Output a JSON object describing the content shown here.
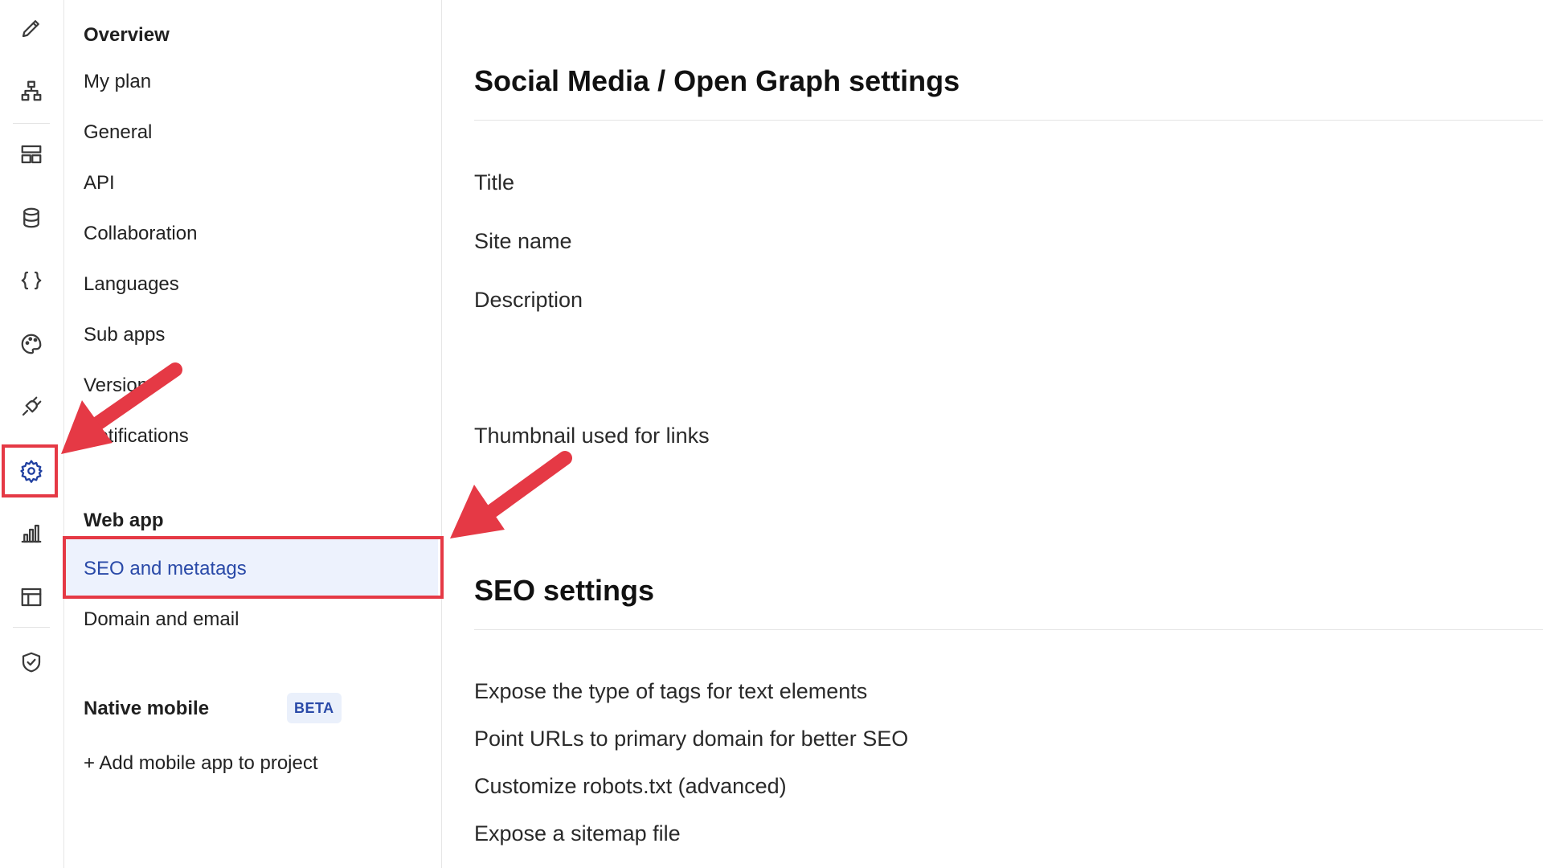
{
  "rail": {
    "icons": [
      "pencil-icon",
      "hierarchy-icon",
      "layout-icon",
      "database-icon",
      "code-braces-icon",
      "palette-icon",
      "plug-icon",
      "gear-icon",
      "bar-chart-icon",
      "table-icon",
      "shield-check-icon"
    ],
    "active": "gear-icon",
    "accent_color": "#1f3fa0",
    "highlight_color": "#e53945"
  },
  "nav": {
    "overview_heading": "Overview",
    "items": [
      "My plan",
      "General",
      "API",
      "Collaboration",
      "Languages",
      "Sub apps",
      "Versions",
      "Notifications"
    ],
    "webapp_heading": "Web app",
    "webapp_items": [
      "SEO and metatags",
      "Domain and email"
    ],
    "selected": "SEO and metatags",
    "native_heading": "Native mobile",
    "native_badge": "BETA",
    "add_mobile": "+ Add mobile app to project"
  },
  "main": {
    "og_title": "Social Media / Open Graph settings",
    "og_fields": [
      "Title",
      "Site name",
      "Description"
    ],
    "thumbnail_label": "Thumbnail used for links",
    "seo_title": "SEO settings",
    "seo_fields": [
      "Expose the type of tags for text elements",
      "Point URLs to primary domain for better SEO",
      "Customize robots.txt (advanced)",
      "Expose a sitemap file"
    ]
  },
  "colors": {
    "selected_bg": "#edf2fd",
    "selected_text": "#2a4aa8",
    "annotation_red": "#e53945"
  }
}
